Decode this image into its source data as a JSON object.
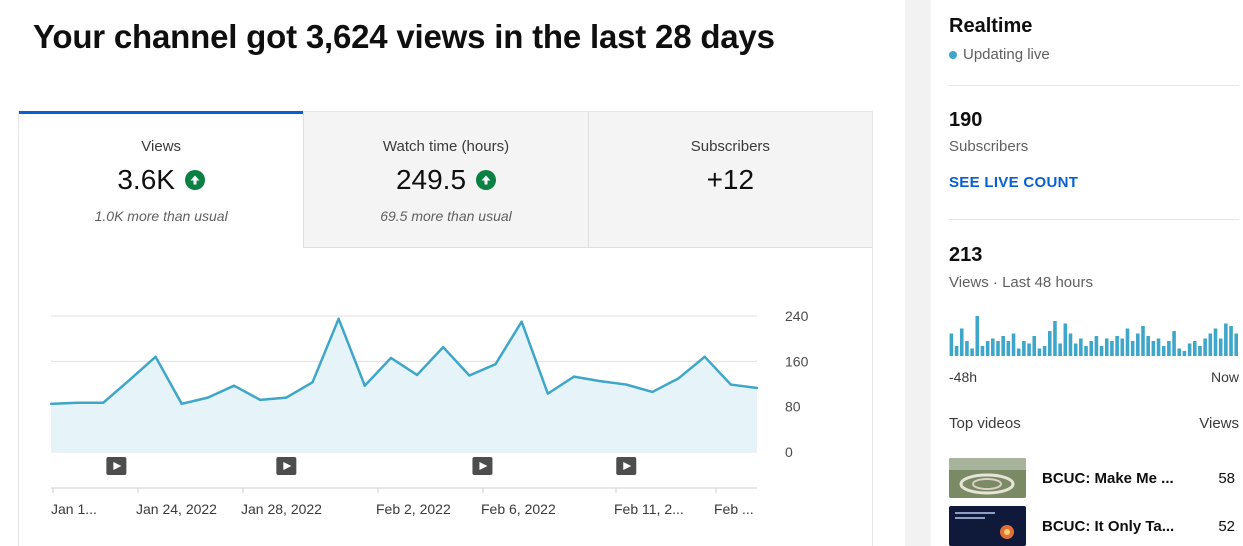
{
  "headline": "Your channel got 3,624 views in the last 28 days",
  "tabs": [
    {
      "label": "Views",
      "value": "3.6K",
      "note": "1.0K more than usual",
      "trend": "up",
      "active": true
    },
    {
      "label": "Watch time (hours)",
      "value": "249.5",
      "note": "69.5 more than usual",
      "trend": "up",
      "active": false
    },
    {
      "label": "Subscribers",
      "value": "+12",
      "note": "",
      "trend": "",
      "active": false
    }
  ],
  "chart_data": {
    "type": "area",
    "series": [
      {
        "values": [
          85,
          87,
          87,
          127,
          168,
          85,
          96,
          117,
          92,
          96,
          123,
          235,
          117,
          166,
          136,
          185,
          135,
          155,
          230,
          103,
          133,
          125,
          119,
          106,
          130,
          168,
          119,
          113
        ]
      }
    ],
    "x_tick_labels": [
      "Jan 1...",
      "Jan 24, 2022",
      "Jan 28, 2022",
      "Feb 2, 2022",
      "Feb 6, 2022",
      "Feb 11, 2...",
      "Feb ..."
    ],
    "y_ticks": [
      240,
      160,
      80,
      0
    ],
    "ylim": [
      0,
      260
    ],
    "grid": true,
    "colors": {
      "line": "#3ea6c8",
      "fill": "#e6f3f8",
      "grid": "#e0e0e0"
    }
  },
  "video_markers": [
    2.5,
    9,
    16.5,
    22
  ],
  "realtime": {
    "title": "Realtime",
    "status": "Updating live",
    "subscribers_count": "190",
    "subscribers_label": "Subscribers",
    "live_count_link": "SEE LIVE COUNT",
    "views_count": "213",
    "views_label": "Views · Last 48 hours",
    "axis_start": "-48h",
    "axis_end": "Now",
    "hourly_views": [
      9,
      4,
      11,
      6,
      3,
      16,
      4,
      6,
      7,
      6,
      8,
      6,
      9,
      3,
      6,
      5,
      8,
      3,
      4,
      10,
      14,
      5,
      13,
      9,
      5,
      7,
      4,
      6,
      8,
      4,
      7,
      6,
      8,
      7,
      11,
      6,
      9,
      12,
      8,
      6,
      7,
      4,
      6,
      10,
      3,
      2,
      5,
      6,
      4,
      7,
      9,
      11,
      7,
      13,
      12,
      9
    ]
  },
  "top_videos": {
    "header": "Top videos",
    "views_header": "Views",
    "items": [
      {
        "title": "BCUC: Make Me ...",
        "views": "58"
      },
      {
        "title": "BCUC: It Only Ta...",
        "views": "52"
      }
    ]
  }
}
